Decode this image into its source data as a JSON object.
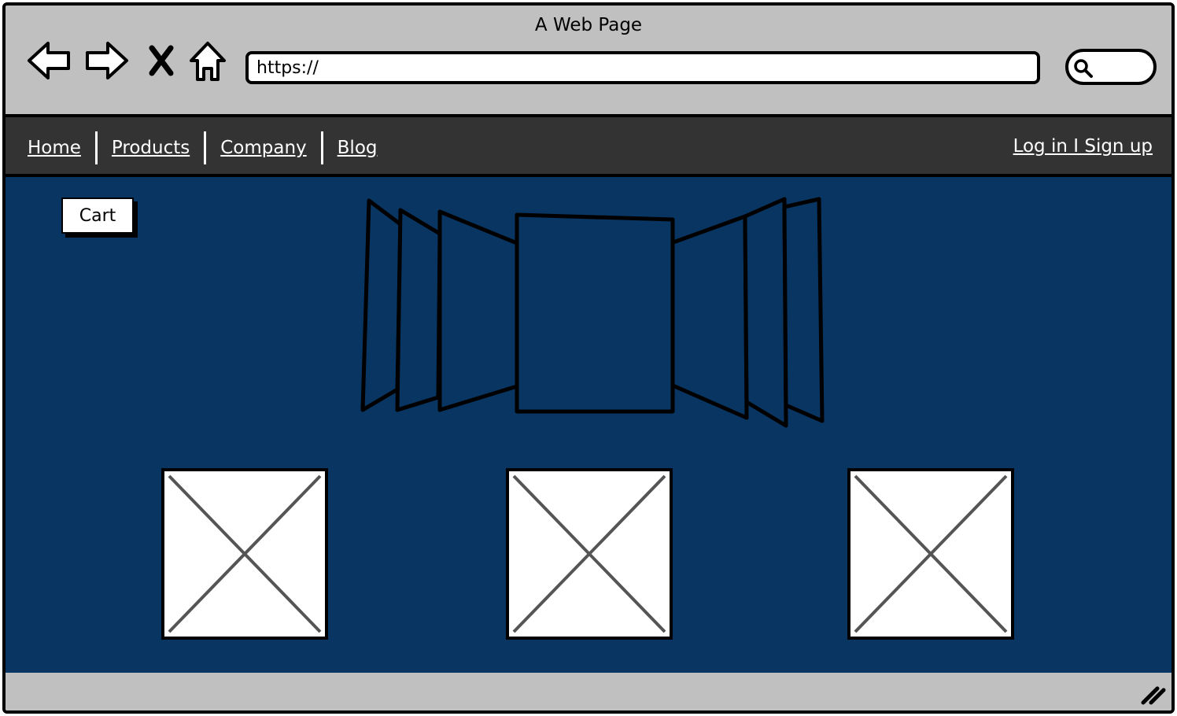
{
  "window": {
    "title": "A Web Page"
  },
  "toolbar": {
    "url_value": "https://",
    "buttons": {
      "back": "back-arrow-icon",
      "forward": "forward-arrow-icon",
      "stop": "close-icon",
      "home": "home-icon",
      "search": "search-icon"
    }
  },
  "navbar": {
    "links": [
      "Home",
      "Products",
      "Company",
      "Blog"
    ],
    "auth": "Log in I Sign up"
  },
  "content": {
    "cart_label": "Cart",
    "carousel": "cover-flow-carousel",
    "images": [
      "image-placeholder",
      "image-placeholder",
      "image-placeholder"
    ]
  },
  "colors": {
    "chrome": "#c0c0c0",
    "navbar": "#333333",
    "content_bg": "#083561",
    "panel_white": "#ffffff"
  }
}
